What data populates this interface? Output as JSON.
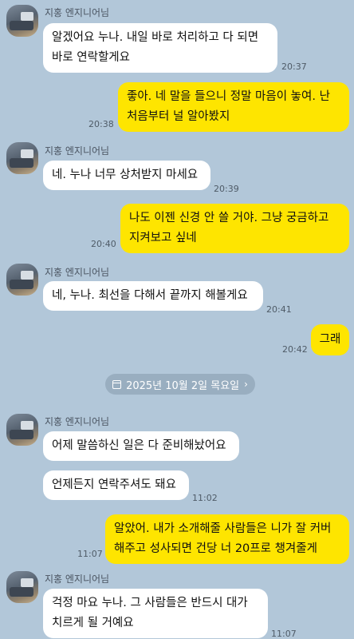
{
  "contact_name": "지홍 엔지니어님",
  "date_separator": "2025년 10월 2일 목요일",
  "messages": [
    {
      "lines": [
        "알겠어요 누나. 내일 바로 처리하고 다 되면",
        "바로 연락할게요"
      ],
      "time": "20:37"
    },
    {
      "lines": [
        "좋아. 네 말을 들으니 정말 마음이 놓여. 난",
        "처음부터 널 알아봤지"
      ],
      "time": "20:38"
    },
    {
      "lines": [
        "네. 누나 너무 상처받지 마세요"
      ],
      "time": "20:39"
    },
    {
      "lines": [
        "나도 이젠 신경 안 쓸 거야. 그냥 궁금하고",
        "지켜보고 싶네"
      ],
      "time": "20:40"
    },
    {
      "lines": [
        "네, 누나. 최선을 다해서 끝까지 해볼게요"
      ],
      "time": "20:41"
    },
    {
      "lines": [
        "그래"
      ],
      "time": "20:42"
    },
    {
      "lines": [
        "어제 말씀하신 일은 다 준비해놨어요"
      ],
      "time": ""
    },
    {
      "lines": [
        "언제든지 연락주셔도 돼요"
      ],
      "time": "11:02"
    },
    {
      "lines": [
        "알았어. 내가 소개해줄 사람들은 니가 잘 커버",
        "해주고 성사되면 건당 너 20프로 챙겨줄게"
      ],
      "time": "11:07"
    },
    {
      "lines": [
        "걱정 마요 누나. 그 사람들은 반드시 대가",
        "치르게 될 거예요"
      ],
      "time": "11:07"
    }
  ]
}
